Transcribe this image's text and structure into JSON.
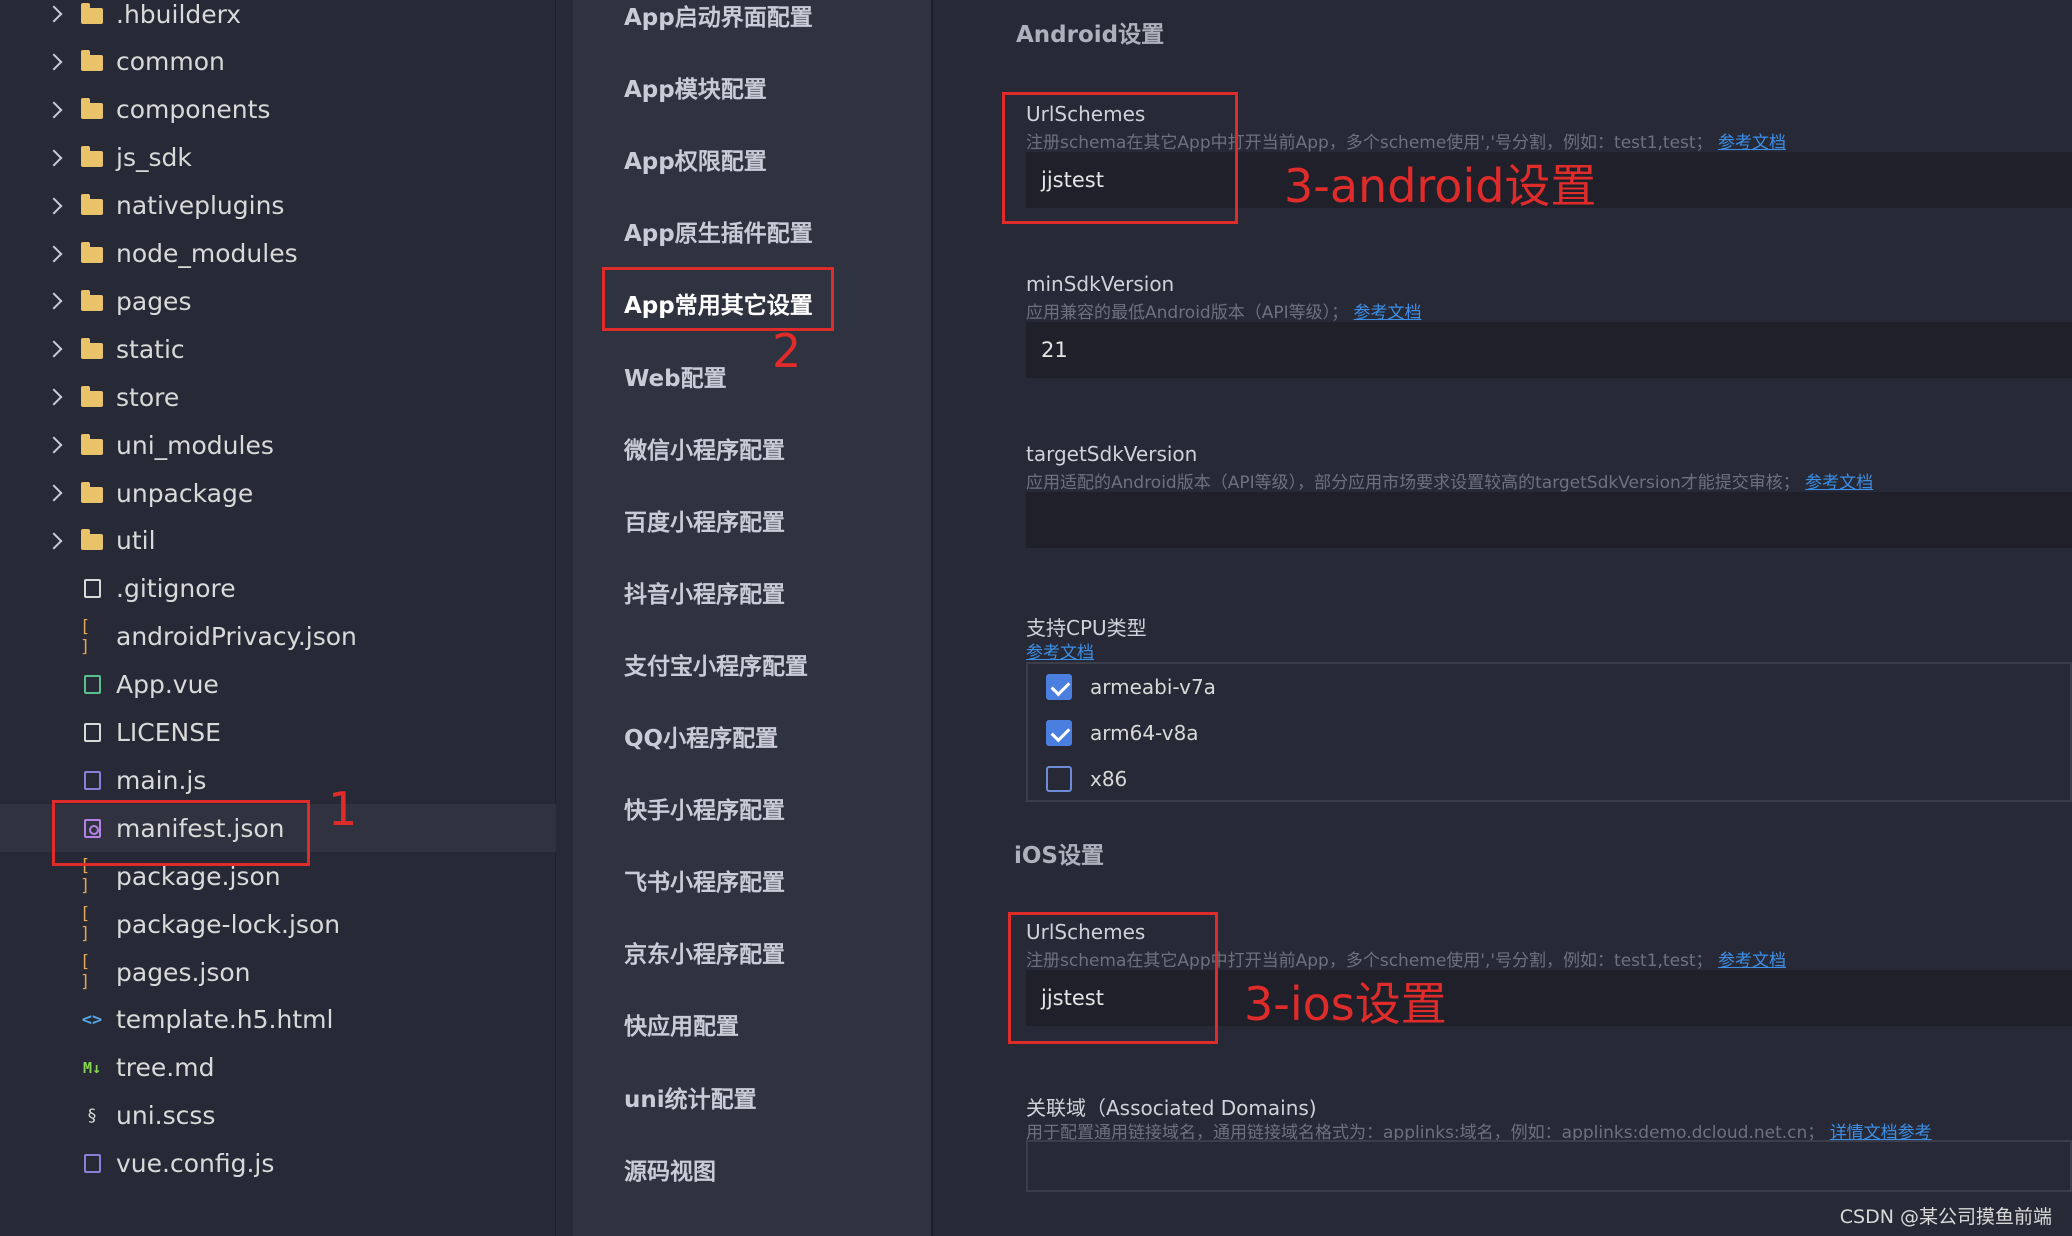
{
  "tree": {
    "items": [
      {
        "label": ".hbuilderx",
        "kind": "folder",
        "icon": "folder-icon"
      },
      {
        "label": "common",
        "kind": "folder",
        "icon": "folder-icon"
      },
      {
        "label": "components",
        "kind": "folder",
        "icon": "folder-icon"
      },
      {
        "label": "js_sdk",
        "kind": "folder",
        "icon": "folder-icon"
      },
      {
        "label": "nativeplugins",
        "kind": "folder",
        "icon": "folder-icon"
      },
      {
        "label": "node_modules",
        "kind": "folder",
        "icon": "folder-icon"
      },
      {
        "label": "pages",
        "kind": "folder",
        "icon": "folder-icon"
      },
      {
        "label": "static",
        "kind": "folder",
        "icon": "folder-icon"
      },
      {
        "label": "store",
        "kind": "folder",
        "icon": "folder-icon"
      },
      {
        "label": "uni_modules",
        "kind": "folder",
        "icon": "folder-icon"
      },
      {
        "label": "unpackage",
        "kind": "folder",
        "icon": "folder-icon"
      },
      {
        "label": "util",
        "kind": "folder",
        "icon": "folder-icon"
      },
      {
        "label": ".gitignore",
        "kind": "file",
        "icon": "file-icon"
      },
      {
        "label": "androidPrivacy.json",
        "kind": "json",
        "icon": "json-bracket-icon"
      },
      {
        "label": "App.vue",
        "kind": "vue",
        "icon": "vue-file-icon"
      },
      {
        "label": "LICENSE",
        "kind": "file",
        "icon": "file-icon"
      },
      {
        "label": "main.js",
        "kind": "js",
        "icon": "js-file-icon"
      },
      {
        "label": "manifest.json",
        "kind": "manifest",
        "icon": "manifest-gear-icon"
      },
      {
        "label": "package.json",
        "kind": "json",
        "icon": "json-bracket-icon"
      },
      {
        "label": "package-lock.json",
        "kind": "json",
        "icon": "json-bracket-icon"
      },
      {
        "label": "pages.json",
        "kind": "json",
        "icon": "json-bracket-icon"
      },
      {
        "label": "template.h5.html",
        "kind": "html",
        "icon": "html-code-icon"
      },
      {
        "label": "tree.md",
        "kind": "md",
        "icon": "markdown-icon"
      },
      {
        "label": "uni.scss",
        "kind": "scss",
        "icon": "scss-icon"
      },
      {
        "label": "vue.config.js",
        "kind": "js",
        "icon": "js-file-icon"
      }
    ],
    "selected": "manifest.json"
  },
  "nav": {
    "items": [
      "App启动界面配置",
      "App模块配置",
      "App权限配置",
      "App原生插件配置",
      "App常用其它设置",
      "Web配置",
      "微信小程序配置",
      "百度小程序配置",
      "抖音小程序配置",
      "支付宝小程序配置",
      "QQ小程序配置",
      "快手小程序配置",
      "飞书小程序配置",
      "京东小程序配置",
      "快应用配置",
      "uni统计配置",
      "源码视图"
    ],
    "active": "App常用其它设置"
  },
  "android": {
    "title": "Android设置",
    "urlschemes": {
      "label": "UrlSchemes",
      "desc": "注册schema在其它App中打开当前App，多个scheme使用','号分割，例如：test1,test；",
      "link": "参考文档",
      "value": "jjstest"
    },
    "minsdk": {
      "label": "minSdkVersion",
      "desc": "应用兼容的最低Android版本（API等级）；",
      "link": "参考文档",
      "value": "21"
    },
    "targetsdk": {
      "label": "targetSdkVersion",
      "desc": "应用适配的Android版本（API等级），部分应用市场要求设置较高的targetSdkVersion才能提交审核；",
      "link": "参考文档",
      "value": ""
    },
    "cpu": {
      "label": "支持CPU类型",
      "link": "参考文档",
      "options": [
        {
          "label": "armeabi-v7a",
          "checked": true
        },
        {
          "label": "arm64-v8a",
          "checked": true
        },
        {
          "label": "x86",
          "checked": false
        }
      ]
    }
  },
  "ios": {
    "title": "iOS设置",
    "urlschemes": {
      "label": "UrlSchemes",
      "desc": "注册schema在其它App中打开当前App，多个scheme使用','号分割，例如：test1,test；",
      "link": "参考文档",
      "value": "jjstest"
    },
    "domains": {
      "label": "关联域（Associated Domains)",
      "desc": "用于配置通用链接域名，通用链接域名格式为：applinks:域名，例如：applinks:demo.dcloud.net.cn；",
      "link": "详情文档参考",
      "value": ""
    }
  },
  "annotations": {
    "step1": "1",
    "step2": "2",
    "step3_android": "3-android设置",
    "step3_ios": "3-ios设置",
    "color": "#e02b2b"
  },
  "watermark": "CSDN @某公司摸鱼前端"
}
